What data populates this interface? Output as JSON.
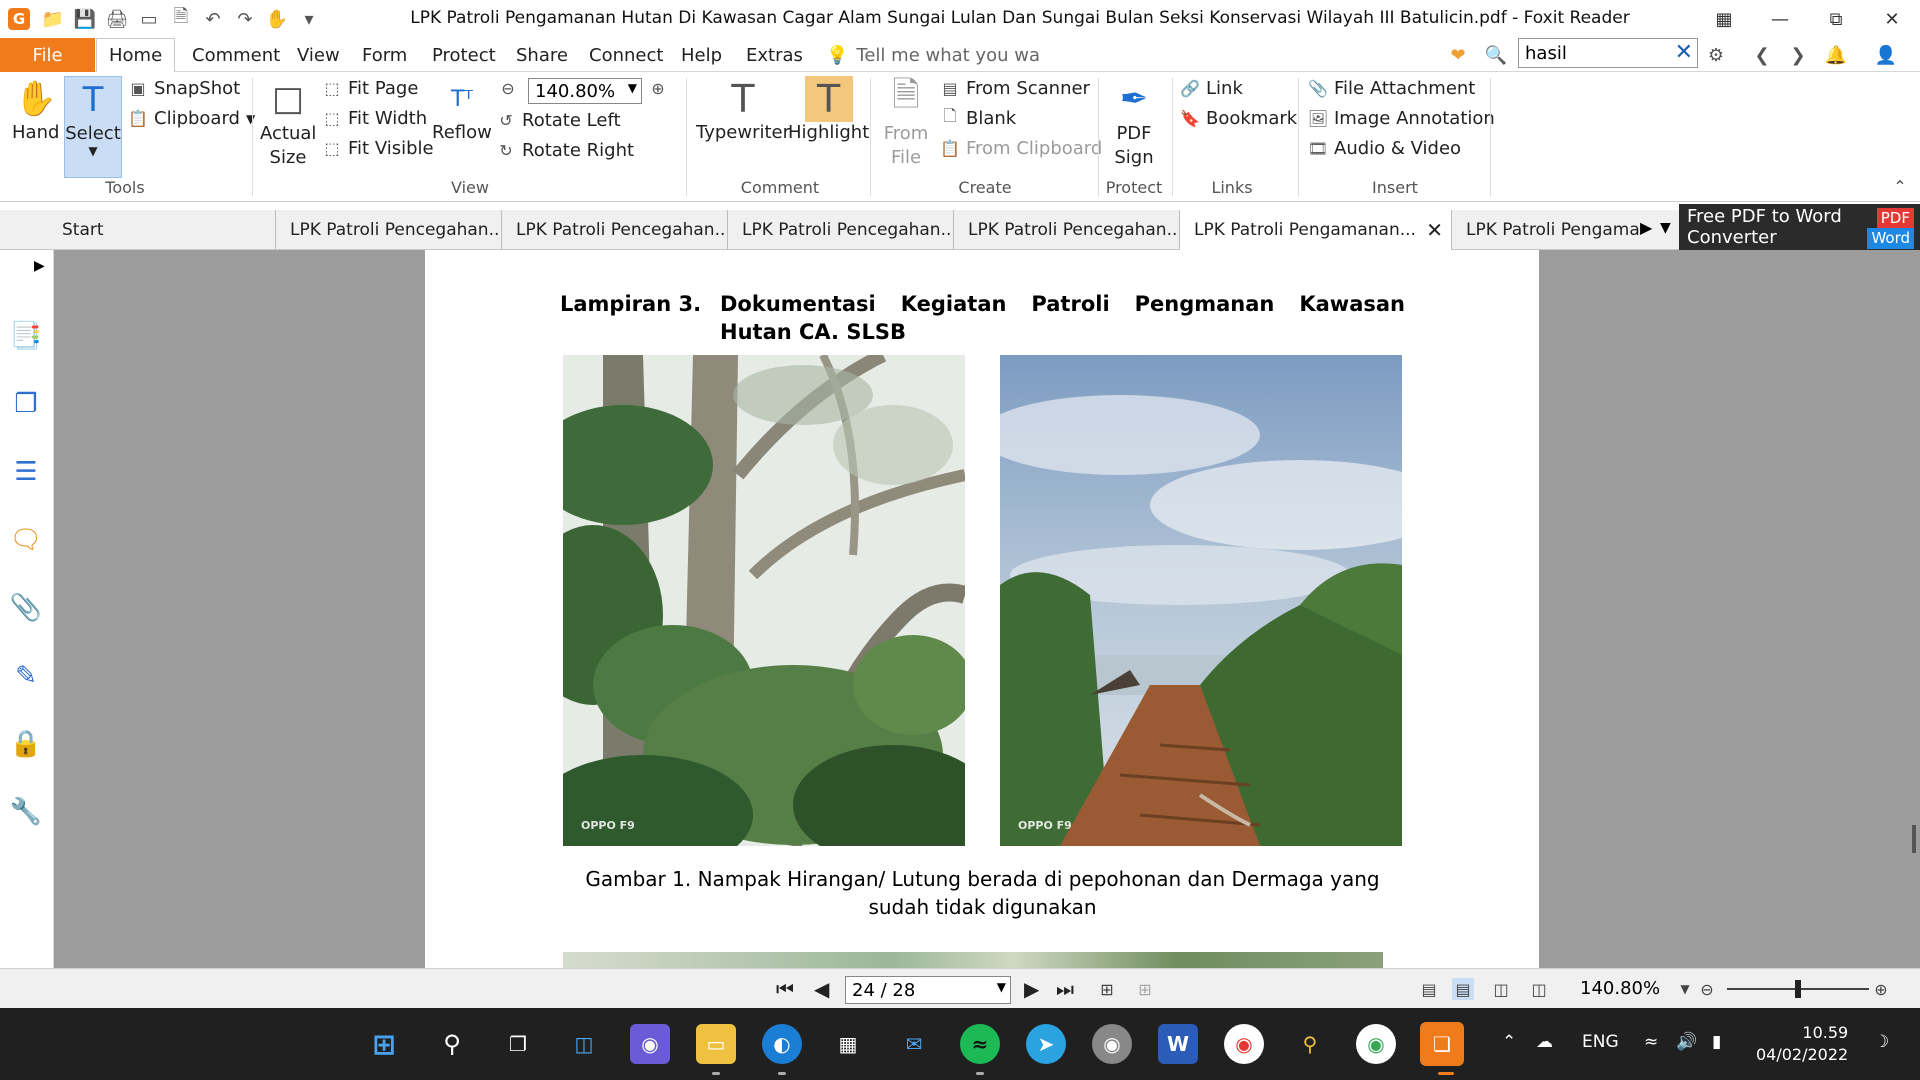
{
  "window": {
    "title": "LPK Patroli Pengamanan Hutan Di Kawasan Cagar Alam Sungai Lulan Dan Sungai Bulan Seksi Konservasi Wilayah III Batulicin.pdf - Foxit Reader",
    "app_logo": "G"
  },
  "ribbon_tabs": [
    "File",
    "Home",
    "Comment",
    "View",
    "Form",
    "Protect",
    "Share",
    "Connect",
    "Help",
    "Extras"
  ],
  "tell_me": "Tell me what you wa",
  "search": {
    "value": "hasil"
  },
  "ribbon": {
    "tools": {
      "group": "Tools",
      "hand": "Hand",
      "select": "Select",
      "snapshot": "SnapShot",
      "clipboard": "Clipboard"
    },
    "view": {
      "group": "View",
      "actual_size": "Actual Size",
      "fit_page": "Fit Page",
      "fit_width": "Fit Width",
      "fit_visible": "Fit Visible",
      "reflow": "Reflow",
      "zoom": "140.80%",
      "rotate_left": "Rotate Left",
      "rotate_right": "Rotate Right"
    },
    "comment": {
      "group": "Comment",
      "typewriter": "Typewriter",
      "highlight": "Highlight"
    },
    "create": {
      "group": "Create",
      "from_file": "From File",
      "from_scanner": "From Scanner",
      "blank": "Blank",
      "from_clipboard": "From Clipboard"
    },
    "protect": {
      "group": "Protect",
      "pdf_sign": "PDF Sign"
    },
    "links": {
      "group": "Links",
      "link": "Link",
      "bookmark": "Bookmark"
    },
    "insert": {
      "group": "Insert",
      "file_attachment": "File Attachment",
      "image_annotation": "Image Annotation",
      "audio_video": "Audio & Video"
    }
  },
  "doc_tabs": [
    {
      "label": "Start"
    },
    {
      "label": "LPK Patroli Pencegahan..."
    },
    {
      "label": "LPK Patroli Pencegahan..."
    },
    {
      "label": "LPK Patroli Pencegahan..."
    },
    {
      "label": "LPK Patroli Pencegahan..."
    },
    {
      "label": "LPK Patroli Pengamanan..."
    },
    {
      "label": "LPK Patroli Pengamar"
    }
  ],
  "promo": {
    "line1": "Free PDF to Word",
    "line2": "Converter",
    "badge_pdf": "PDF",
    "badge_word": "Word"
  },
  "document": {
    "heading_label": "Lampiran 3.",
    "heading_text": "Dokumentasi Kegiatan Patroli Pengmanan Kawasan Hutan CA. SLSB",
    "photo_watermark": "OPPO F9",
    "caption": "Gambar 1. Nampak Hirangan/ Lutung berada di pepohonan dan Dermaga yang sudah tidak digunakan"
  },
  "statusbar": {
    "page": "24 / 28",
    "zoom": "140.80%",
    "zoom_slider_fraction": 0.5
  },
  "taskbar": {
    "language": "ENG",
    "time": "10.59",
    "date": "04/02/2022",
    "word_icon_letter": "W"
  },
  "colors": {
    "accent": "#f07b1a",
    "select_highlight": "#c9def5",
    "doc_background": "#9c9c9c",
    "taskbar": "#202020"
  }
}
